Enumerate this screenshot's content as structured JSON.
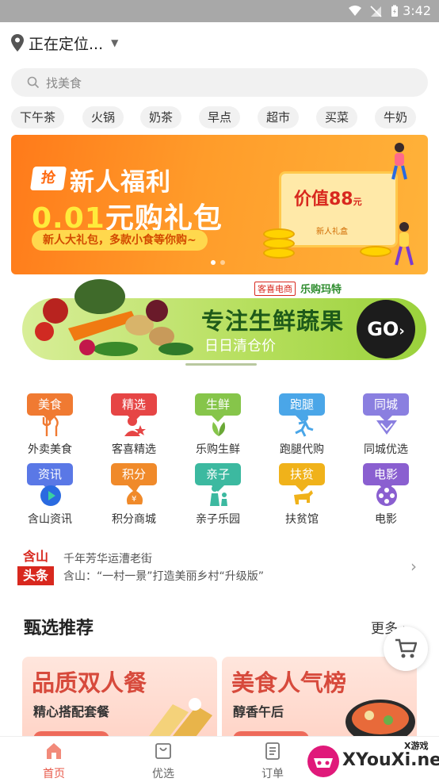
{
  "status_bar": {
    "time": "3:42"
  },
  "location": {
    "text": "正在定位..."
  },
  "search": {
    "placeholder": "找美食"
  },
  "chips": [
    "下午茶",
    "火锅",
    "奶茶",
    "早点",
    "超市",
    "买菜",
    "牛奶"
  ],
  "banner": {
    "tag": "抢",
    "title": "新人福利",
    "price": "0.01",
    "price_suffix": "元购礼包",
    "subtitle": "新人大礼包，多款小食等你购~",
    "card_value": "价值88",
    "card_unit": "元",
    "card_sub": "新人礼盒"
  },
  "green_banner": {
    "brand_left": "客喜电商",
    "brand_right": "乐购玛特",
    "headline": "专注生鲜蔬果",
    "subline": "日日清仓价",
    "go": "GO"
  },
  "categories": [
    {
      "badge": "美食",
      "label": "外卖美食",
      "color": "#f07a32",
      "icon": "utensils-icon"
    },
    {
      "badge": "精选",
      "label": "客喜精选",
      "color": "#e64545",
      "icon": "star-person-icon"
    },
    {
      "badge": "生鲜",
      "label": "乐购生鲜",
      "color": "#86c54a",
      "icon": "vegetable-icon"
    },
    {
      "badge": "跑腿",
      "label": "跑腿代购",
      "color": "#4aa6e8",
      "icon": "runner-icon"
    },
    {
      "badge": "同城",
      "label": "同城优选",
      "color": "#8a7fe0",
      "icon": "diamond-icon"
    },
    {
      "badge": "资讯",
      "label": "含山资讯",
      "color": "#5a78e6",
      "icon": "play-icon"
    },
    {
      "badge": "积分",
      "label": "积分商城",
      "color": "#f08a2a",
      "icon": "money-bag-icon"
    },
    {
      "badge": "亲子",
      "label": "亲子乐园",
      "color": "#3cb9a0",
      "icon": "family-icon"
    },
    {
      "badge": "扶贫",
      "label": "扶贫馆",
      "color": "#f0b21a",
      "icon": "ox-icon"
    },
    {
      "badge": "电影",
      "label": "电影",
      "color": "#8a5fd0",
      "icon": "film-reel-icon"
    }
  ],
  "news": {
    "logo_top": "含山",
    "logo_bottom": "头条",
    "line1": "千年芳华运漕老街",
    "line2": "含山：“一村一景”打造美丽乡村“升级版”"
  },
  "section": {
    "title": "甄选推荐",
    "more": "更多"
  },
  "promos": [
    {
      "title": "品质双人餐",
      "subtitle": "精心搭配套餐"
    },
    {
      "title": "美食人气榜",
      "subtitle": "醇香午后"
    }
  ],
  "tabs": [
    {
      "label": "首页",
      "icon": "home-icon",
      "active": true
    },
    {
      "label": "优选",
      "icon": "bag-icon",
      "active": false
    },
    {
      "label": "订单",
      "icon": "order-icon",
      "active": false
    }
  ],
  "watermark": {
    "text": "XYouXi.net",
    "small": "X游戏"
  }
}
